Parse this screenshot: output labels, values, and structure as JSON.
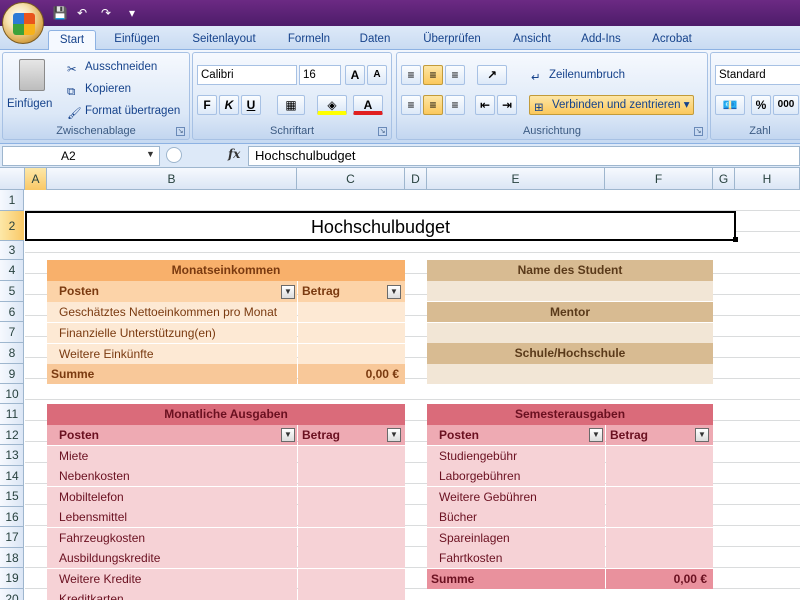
{
  "quick_access": {
    "save_icon": "save-icon",
    "undo_icon": "undo-icon",
    "redo_icon": "redo-icon"
  },
  "tabs": [
    "Start",
    "Einfügen",
    "Seitenlayout",
    "Formeln",
    "Daten",
    "Überprüfen",
    "Ansicht",
    "Add-Ins",
    "Acrobat"
  ],
  "ribbon": {
    "clipboard": {
      "paste": "Einfügen",
      "cut": "Ausschneiden",
      "copy": "Kopieren",
      "format_painter": "Format übertragen",
      "label": "Zwischenablage"
    },
    "font": {
      "name": "Calibri",
      "size": "16",
      "bold": "F",
      "italic": "K",
      "underline": "U",
      "label": "Schriftart",
      "grow": "A",
      "shrink": "A"
    },
    "alignment": {
      "wrap": "Zeilenumbruch",
      "merge": "Verbinden und zentrieren",
      "label": "Ausrichtung"
    },
    "number": {
      "format": "Standard",
      "percent": "%",
      "thousands": "000",
      "label": "Zahl"
    }
  },
  "formula": {
    "namebox": "A2",
    "fx": "fx",
    "content": "Hochschulbudget"
  },
  "columns": [
    "A",
    "B",
    "C",
    "D",
    "E",
    "F",
    "G",
    "H"
  ],
  "rows": [
    "1",
    "2",
    "3",
    "4",
    "5",
    "6",
    "7",
    "8",
    "9",
    "10",
    "11",
    "12",
    "13",
    "14",
    "15",
    "16",
    "17",
    "18",
    "19",
    "20"
  ],
  "sheet": {
    "title": "Hochschulbudget",
    "income": {
      "header": "Monatseinkommen",
      "col_item": "Posten",
      "col_amount": "Betrag",
      "items": [
        "Geschätztes Nettoeinkommen pro Monat",
        "Finanzielle Unterstützung(en)",
        "Weitere Einkünfte"
      ],
      "total_label": "Summe",
      "total_value": "0,00 €"
    },
    "info": {
      "student": "Name des Student",
      "mentor": "Mentor",
      "school": "Schule/Hochschule"
    },
    "monthly": {
      "header": "Monatliche Ausgaben",
      "col_item": "Posten",
      "col_amount": "Betrag",
      "items": [
        "Miete",
        "Nebenkosten",
        "Mobiltelefon",
        "Lebensmittel",
        "Fahrzeugkosten",
        "Ausbildungskredite",
        "Weitere Kredite",
        "Kreditkarten"
      ]
    },
    "semester": {
      "header": "Semesterausgaben",
      "col_item": "Posten",
      "col_amount": "Betrag",
      "items": [
        "Studiengebühr",
        "Laborgebühren",
        "Weitere Gebühren",
        "Bücher",
        "Spareinlagen",
        "Fahrtkosten"
      ],
      "total_label": "Summe",
      "total_value": "0,00 €"
    }
  },
  "colors": {
    "income_header": "#f8b06b",
    "income_sub": "#fcd3a8",
    "income_body": "#fde9d4",
    "info_header": "#d8bb92",
    "info_body": "#f2e6d6",
    "expense_header": "#da6b7a",
    "expense_sub": "#eeaab3",
    "expense_body": "#f6d2d6"
  }
}
